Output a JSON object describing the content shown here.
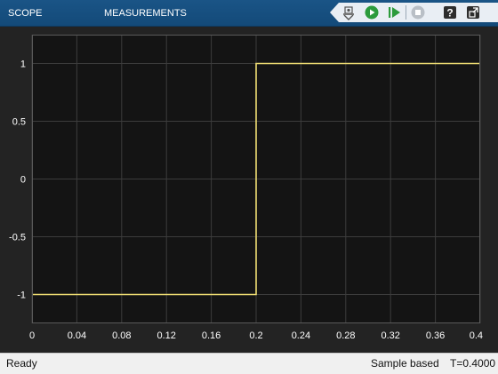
{
  "toolstrip": {
    "tabs": [
      {
        "label": "SCOPE"
      },
      {
        "label": "MEASUREMENTS"
      }
    ]
  },
  "toolbar": {
    "icons": [
      "highlight-block-icon",
      "run-icon",
      "step-forward-icon",
      "stop-icon",
      "help-icon",
      "undock-icon"
    ]
  },
  "colors": {
    "toolstrip": "#134a79",
    "plot_background": "#141414",
    "grid": "#3c3c3c",
    "signal": "#eedc72",
    "text": "#ffffff"
  },
  "chart_data": {
    "type": "line",
    "title": "",
    "xlabel": "",
    "ylabel": "",
    "xlim": [
      0,
      0.4
    ],
    "ylim": [
      -1.25,
      1.25
    ],
    "grid": true,
    "x_ticks": [
      0,
      0.04,
      0.08,
      0.12,
      0.16,
      0.2,
      0.24,
      0.28,
      0.32,
      0.36,
      0.4
    ],
    "x_tick_labels": [
      "0",
      "0.04",
      "0.08",
      "0.12",
      "0.16",
      "0.2",
      "0.24",
      "0.28",
      "0.32",
      "0.36",
      "0.4"
    ],
    "y_ticks": [
      1,
      0.5,
      0,
      -0.5,
      -1
    ],
    "y_tick_labels": [
      "1",
      "0.5",
      "0",
      "-0.5",
      "-1"
    ],
    "series": [
      {
        "x": [
          0,
          0.2,
          0.2,
          0.4
        ],
        "y": [
          -1,
          -1,
          1,
          1
        ]
      }
    ]
  },
  "status": {
    "left": "Ready",
    "mode": "Sample based",
    "time": "T=0.4000"
  }
}
